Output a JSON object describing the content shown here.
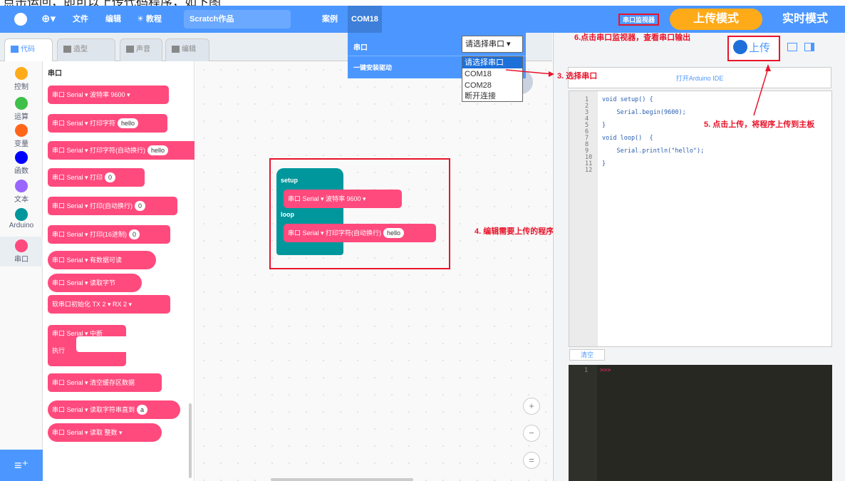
{
  "caption": "点击运回，即可以上传代码程序，如下图",
  "menubar": {
    "file": "文件",
    "edit": "编辑",
    "tutorial": "教程",
    "project_title": "Scratch作品",
    "examples": "案例",
    "port": "COM18",
    "serial_monitor": "串口监视器",
    "upload_mode": "上传模式",
    "realtime_mode": "实时模式"
  },
  "dropdown": {
    "serial": "串口",
    "install_driver": "一键安装驱动",
    "select_placeholder": "请选择串口",
    "options": [
      "请选择串口",
      "COM18",
      "COM28",
      "断开连接"
    ]
  },
  "tabs": {
    "code": "代码",
    "costumes": "造型",
    "sounds": "声音",
    "edit": "编辑"
  },
  "categories": [
    {
      "label": "控制",
      "color": "#ffab19"
    },
    {
      "label": "运算",
      "color": "#40bf4a"
    },
    {
      "label": "变量",
      "color": "#ff661a"
    },
    {
      "label": "函数",
      "color": "#0000ff"
    },
    {
      "label": "文本",
      "color": "#9966ff"
    },
    {
      "label": "Arduino",
      "color": "#00979c"
    },
    {
      "label": "串口",
      "color": "#ff4a7d"
    }
  ],
  "palette": {
    "header": "串口",
    "blocks": [
      {
        "text": "串口 Serial ▾ 波特率 9600 ▾",
        "pill": ""
      },
      {
        "text": "串口 Serial ▾ 打印字符",
        "pill": "hello"
      },
      {
        "text": "串口 Serial ▾ 打印字符(自动换行)",
        "pill": "hello"
      },
      {
        "text": "串口 Serial ▾ 打印",
        "pill": "0"
      },
      {
        "text": "串口 Serial ▾ 打印(自动换行)",
        "pill": "0"
      },
      {
        "text": "串口 Serial ▾ 打印(16进制)",
        "pill": "0"
      },
      {
        "text": "串口 Serial ▾ 有数据可读",
        "pill": ""
      },
      {
        "text": "串口 Serial ▾ 读取字节",
        "pill": ""
      },
      {
        "text": "软串口初始化 TX 2 ▾ RX 2 ▾",
        "pill": ""
      },
      {
        "text": "串口 Serial ▾ 中断",
        "pill": ""
      },
      {
        "text": "串口 Serial ▾ 清空缓存区数据",
        "pill": ""
      },
      {
        "text": "串口 Serial ▾ 读取字符串直到",
        "pill": "a"
      },
      {
        "text": "串口 Serial ▾ 读取 整数 ▾",
        "pill": ""
      }
    ],
    "interrupt_do": "执行"
  },
  "script": {
    "setup": "setup",
    "setup_block": "串口 Serial ▾ 波特率 9600 ▾",
    "loop": "loop",
    "loop_block": "串口 Serial ▾ 打印字符(自动换行)",
    "loop_pill": "hello"
  },
  "right": {
    "upload_button": "上传",
    "open_ide": "打开Arduino IDE",
    "clear": "清空",
    "console_prompt": ">>>",
    "code_lines": [
      "void setup() {",
      "",
      "    Serial.begin(9600);",
      "",
      "}",
      "",
      "void loop()  {",
      "",
      "    Serial.println(\"hello\");",
      "",
      "}",
      ""
    ],
    "line_numbers": [
      "1",
      "2",
      "3",
      "4",
      "5",
      "6",
      "7",
      "8",
      "9",
      "10",
      "11",
      "12"
    ]
  },
  "annotations": {
    "step3": "3. 选择串口",
    "step4": "4. 编辑需要上传的程序",
    "step5": "5. 点击上传，将程序上传到主板",
    "step6": "6.点击串口监视器，查看串口输出"
  },
  "zoom": {
    "in": "+",
    "out": "−",
    "reset": "="
  },
  "colors": {
    "menubar": "#4c97ff",
    "block": "#ff4a7d",
    "arduino": "#00979c",
    "annotation": "#e8142a",
    "upload_mode": "#ffab19"
  }
}
